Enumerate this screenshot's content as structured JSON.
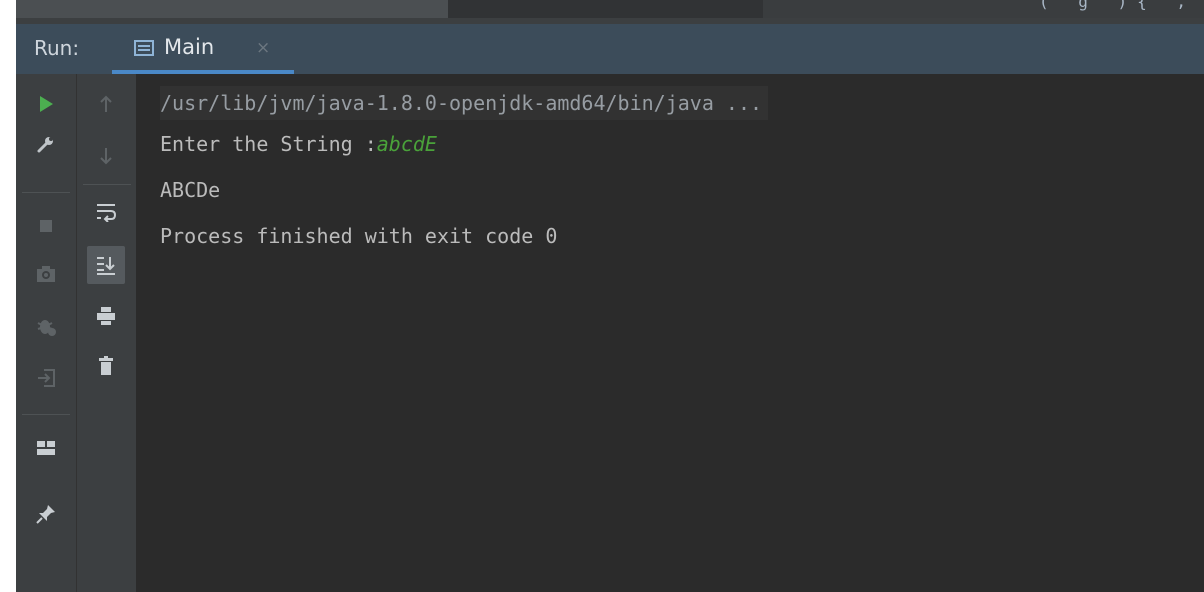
{
  "top_strip": {
    "cut_text": "( g   ){   ,"
  },
  "run_window": {
    "label": "Run:",
    "tab": {
      "label": "Main",
      "close": "×"
    }
  },
  "toolbar_left": {
    "items": [
      "run-icon",
      "wrench-icon",
      "stop-icon",
      "camera-icon",
      "debug-bug-icon",
      "login-icon",
      "layout-icon",
      "pin-icon"
    ]
  },
  "toolbar_right": {
    "items": [
      "arrow-up-icon",
      "arrow-down-icon",
      "soft-wrap-icon",
      "scroll-to-end-icon",
      "print-icon",
      "trash-icon"
    ]
  },
  "console": {
    "command": "/usr/lib/jvm/java-1.8.0-openjdk-amd64/bin/java ...",
    "prompt": "Enter the String :",
    "user_input": "abcdE",
    "output": "ABCDe",
    "exit_message": "Process finished with exit code 0"
  },
  "colors": {
    "run_green": "#4caf50",
    "input_green": "#4aa23a",
    "tab_underline": "#4a88c7",
    "console_bg": "#2b2b2b"
  }
}
